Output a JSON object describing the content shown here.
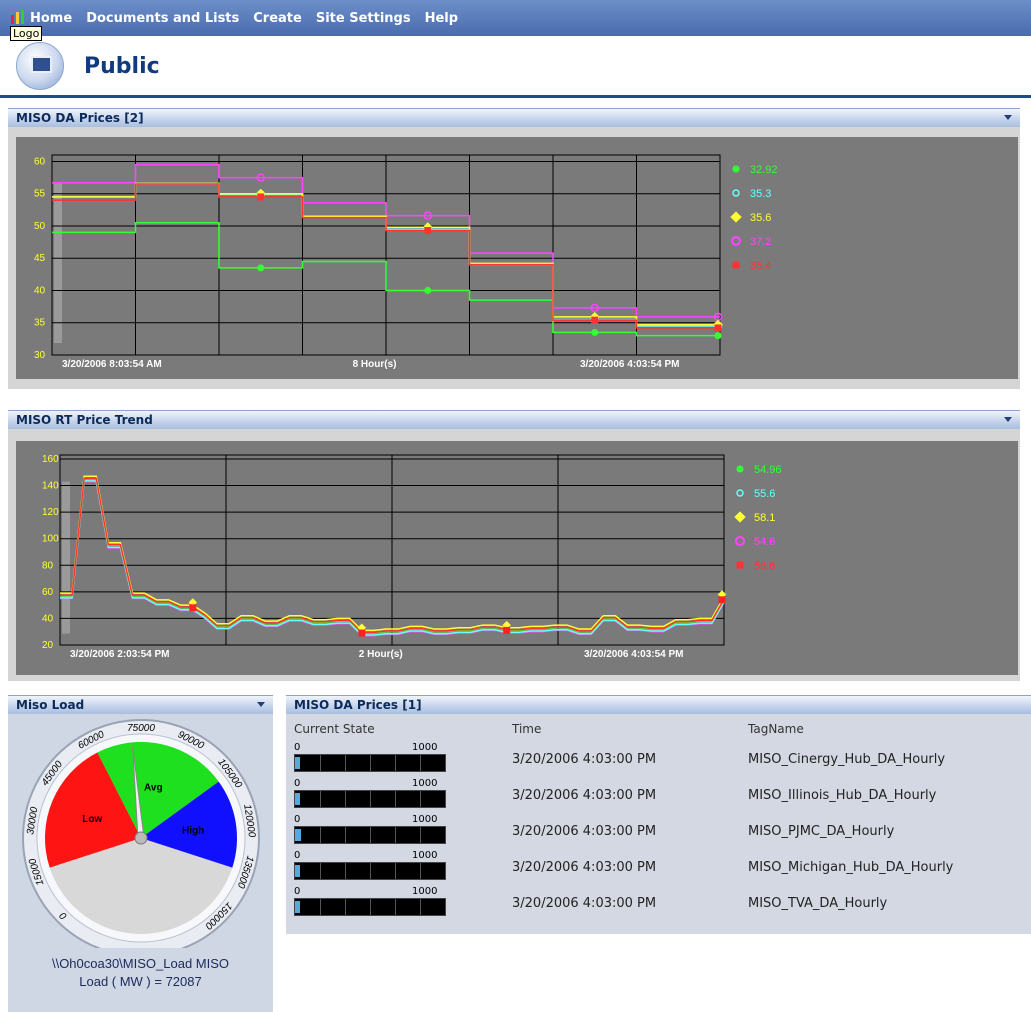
{
  "nav": {
    "items": [
      "Home",
      "Documents and Lists",
      "Create",
      "Site Settings",
      "Help"
    ],
    "tooltip": "Logo"
  },
  "header": {
    "site_title": "Public"
  },
  "webparts": {
    "da_prices_2": {
      "title": "MISO DA Prices [2]"
    },
    "rt_trend": {
      "title": "MISO RT Price Trend"
    },
    "miso_load": {
      "title": "Miso Load"
    },
    "da_prices_1": {
      "title": "MISO DA Prices [1]"
    }
  },
  "chart_data": [
    {
      "type": "line",
      "title": "MISO DA Prices [2]",
      "yticks": [
        "60",
        "55",
        "50",
        "45",
        "40",
        "35",
        "30"
      ],
      "ylim": [
        30,
        61
      ],
      "time_labels": [
        "3/20/2006 8:03:54 AM",
        "8 Hour(s)",
        "3/20/2006 4:03:54 PM"
      ],
      "grid": true,
      "legend_position": "right",
      "series": [
        {
          "name": "",
          "color": "#33ff33",
          "current": "32.92",
          "values": [
            49,
            50.5,
            43.5,
            44.5,
            40,
            38.5,
            33.5,
            33
          ]
        },
        {
          "name": "",
          "color": "#66ffff",
          "current": "35.3",
          "values": [
            54.5,
            56.5,
            54.9,
            51.5,
            49.5,
            44,
            35.5,
            34.5
          ]
        },
        {
          "name": "",
          "color": "#ffff33",
          "current": "35.6",
          "values": [
            54.5,
            56.6,
            55,
            51.5,
            49.8,
            44.2,
            35.9,
            34.7
          ]
        },
        {
          "name": "",
          "color": "#ff44ff",
          "current": "37.2",
          "values": [
            56.7,
            59.5,
            57.5,
            53.6,
            51.6,
            45.8,
            37.3,
            35.9
          ]
        },
        {
          "name": "",
          "color": "#ff3333",
          "current": "35.4",
          "values": [
            54,
            56.5,
            54.5,
            51.3,
            49.3,
            44,
            35.4,
            34.2
          ]
        }
      ]
    },
    {
      "type": "line",
      "title": "MISO RT Price Trend",
      "yticks": [
        "160",
        "140",
        "120",
        "100",
        "80",
        "60",
        "40",
        "20"
      ],
      "ylim": [
        20,
        163
      ],
      "time_labels": [
        "3/20/2006 2:03:54 PM",
        "2 Hour(s)",
        "3/20/2006 4:03:54 PM"
      ],
      "grid": true,
      "legend_position": "right",
      "series": [
        {
          "name": "",
          "color": "#33ff33",
          "current": "54.96"
        },
        {
          "name": "",
          "color": "#66ffff",
          "current": "55.6"
        },
        {
          "name": "",
          "color": "#ffff33",
          "current": "58.1"
        },
        {
          "name": "",
          "color": "#ff44ff",
          "current": "54.6"
        },
        {
          "name": "",
          "color": "#ff3333",
          "current": "56.6"
        }
      ],
      "values": [
        57,
        57,
        145,
        145,
        95,
        95,
        57,
        57,
        52,
        52,
        48,
        48,
        42,
        34,
        34,
        40,
        40,
        36,
        36,
        40,
        40,
        37,
        37,
        38,
        38,
        29,
        29,
        30,
        30,
        32,
        32,
        30,
        30,
        31,
        31,
        33,
        33,
        31,
        31,
        32,
        32,
        33,
        33,
        30,
        30,
        40,
        40,
        33,
        33,
        32,
        32,
        37,
        37,
        38,
        38,
        54
      ]
    }
  ],
  "gauge": {
    "min": 0,
    "max": 150000,
    "value": 72087,
    "tick_labels": [
      "0",
      "15000",
      "30000",
      "45000",
      "60000",
      "75000",
      "90000",
      "105000",
      "120000",
      "135000",
      "150000"
    ],
    "zones": [
      {
        "label": "Low",
        "from": 15000,
        "to": 60000,
        "color": "#ff1414"
      },
      {
        "label": "Avg",
        "from": 60000,
        "to": 105000,
        "color": "#1ee01e"
      },
      {
        "label": "High",
        "from": 105000,
        "to": 135000,
        "color": "#1010ff"
      }
    ],
    "caption_line1": "\\\\Oh0coa30\\MISO_Load MISO",
    "caption_line2": "Load ( MW ) = 72087"
  },
  "da_table": {
    "headers": [
      "Current State",
      "Time",
      "TagName"
    ],
    "bar_min": "0",
    "bar_max": "1000",
    "rows": [
      {
        "time": "3/20/2006 4:03:00 PM",
        "tag": "MISO_Cinergy_Hub_DA_Hourly",
        "state": 35
      },
      {
        "time": "3/20/2006 4:03:00 PM",
        "tag": "MISO_Illinois_Hub_DA_Hourly",
        "state": 33
      },
      {
        "time": "3/20/2006 4:03:00 PM",
        "tag": "MISO_PJMC_DA_Hourly",
        "state": 37
      },
      {
        "time": "3/20/2006 4:03:00 PM",
        "tag": "MISO_Michigan_Hub_DA_Hourly",
        "state": 35
      },
      {
        "time": "3/20/2006 4:03:00 PM",
        "tag": "MISO_TVA_DA_Hourly",
        "state": 33
      }
    ]
  }
}
